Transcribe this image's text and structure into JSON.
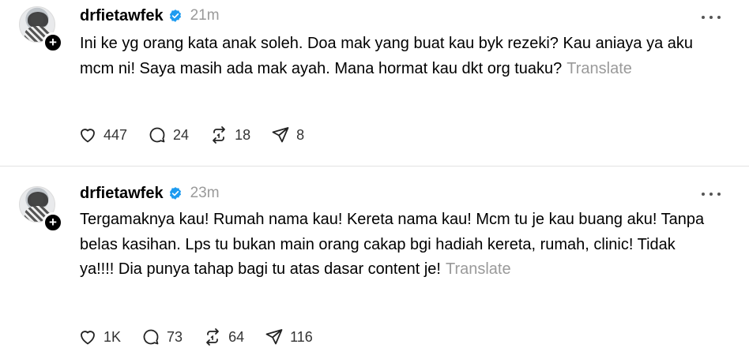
{
  "posts": [
    {
      "username": "drfietawfek",
      "time": "21m",
      "text": "Ini ke yg orang kata anak soleh. Doa mak yang buat kau byk rezeki? Kau aniaya ya aku mcm ni! Saya masih ada mak ayah. Mana hormat kau dkt org tuaku?",
      "translate": "Translate",
      "likes": "447",
      "replies": "24",
      "reposts": "18",
      "shares": "8"
    },
    {
      "username": "drfietawfek",
      "time": "23m",
      "text": "Tergamaknya kau! Rumah nama kau! Kereta nama kau! Mcm tu je kau buang aku! Tanpa belas kasihan. Lps tu bukan main orang cakap bgi hadiah kereta, rumah, clinic! Tidak ya!!!! Dia punya tahap bagi tu atas dasar content je!",
      "translate": "Translate",
      "likes": "1K",
      "replies": "73",
      "reposts": "64",
      "shares": "116"
    }
  ],
  "icons": {
    "follow": "plus-icon",
    "verified": "verified-badge-icon",
    "more": "more-options-icon",
    "like": "heart-icon",
    "reply": "comment-icon",
    "repost": "repost-icon",
    "share": "send-icon"
  },
  "colors": {
    "verified": "#1d9bf0",
    "muted": "#9a9a9a",
    "divider": "#e2e2e2"
  }
}
